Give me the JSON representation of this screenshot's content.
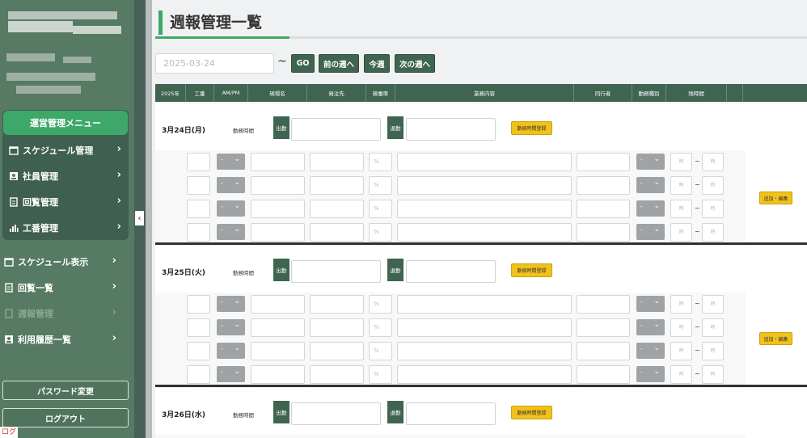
{
  "sidebar": {
    "menu_header": "運営管理メニュー",
    "mgmt_items": [
      {
        "label": "スケジュール管理",
        "icon": "calendar-icon"
      },
      {
        "label": "社員管理",
        "icon": "person-icon"
      },
      {
        "label": "回覧管理",
        "icon": "clipboard-icon"
      },
      {
        "label": "工番管理",
        "icon": "bar-chart-icon"
      }
    ],
    "items": [
      {
        "label": "スケジュール表示",
        "icon": "calendar-icon",
        "disabled": false
      },
      {
        "label": "回覧一覧",
        "icon": "clipboard-icon",
        "disabled": false
      },
      {
        "label": "週報管理",
        "icon": "document-icon",
        "disabled": true
      },
      {
        "label": "利用履歴一覧",
        "icon": "person-icon",
        "disabled": false
      }
    ],
    "password_button": "パスワード変更",
    "logout_button": "ログアウト",
    "collapse_glyph": "‹",
    "chevron": "›",
    "corner_badge": "ログ"
  },
  "main": {
    "title": "週報管理一覧",
    "date_value": "2025-03-24",
    "tilde": "~",
    "buttons": {
      "go": "GO",
      "prev_week": "前の週へ",
      "this_week": "今週",
      "next_week": "次の週へ"
    },
    "columns": [
      "2025年",
      "工番",
      "AM/PM",
      "現場名",
      "発注先",
      "稼働率",
      "業務内容",
      "同行者",
      "勤務種別",
      "残時間"
    ],
    "days": [
      {
        "date": "3月24日(月)"
      },
      {
        "date": "3月25日(火)"
      },
      {
        "date": "3月26日(水)"
      }
    ],
    "day_label": "勤務時間",
    "start_tag": "出勤",
    "end_tag": "退勤",
    "register_button": "勤務時間登録",
    "edit_button": "追加・編集",
    "select_dash": "-",
    "select_caret": "⌄",
    "percent": "%",
    "time_placeholder": "時",
    "range_sep": "~"
  }
}
